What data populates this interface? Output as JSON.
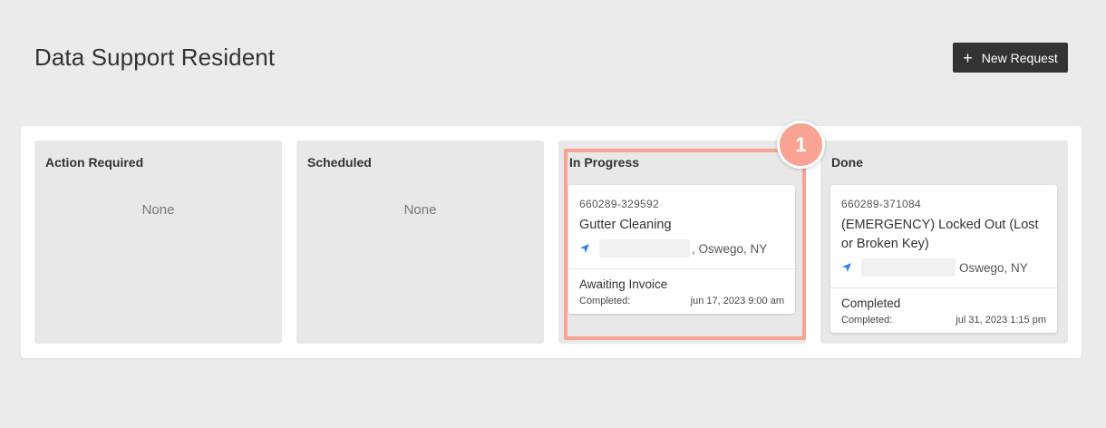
{
  "header": {
    "title": "Data Support Resident",
    "new_request_label": "New Request"
  },
  "columns": [
    {
      "title": "Action Required",
      "empty_text": "None"
    },
    {
      "title": "Scheduled",
      "empty_text": "None"
    },
    {
      "title": "In Progress",
      "card": {
        "id": "660289-329592",
        "title": "Gutter Cleaning",
        "address": ", Oswego, NY",
        "status": "Awaiting Invoice",
        "completed_label": "Completed:",
        "completed_value": "jun 17, 2023 9:00 am"
      }
    },
    {
      "title": "Done",
      "card": {
        "id": "660289-371084",
        "title": "(EMERGENCY) Locked Out (Lost or Broken Key)",
        "address": "Oswego, NY",
        "status": "Completed",
        "completed_label": "Completed:",
        "completed_value": "jul 31, 2023 1:15 pm"
      }
    }
  ],
  "annotation": {
    "step": "1"
  },
  "colors": {
    "accent": "#f8a393",
    "button": "#333333",
    "nav_icon": "#2f80ed"
  }
}
